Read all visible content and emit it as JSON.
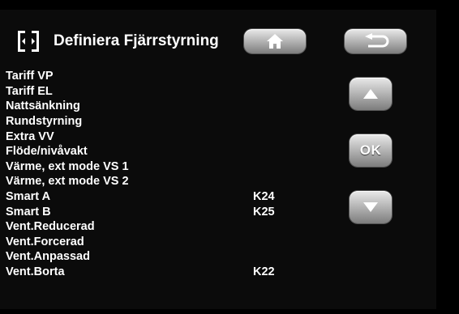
{
  "header": {
    "title": "Definiera Fjärrstyrning",
    "icon": "remote-bracket-icon"
  },
  "buttons": {
    "home": {
      "icon": "home-icon"
    },
    "back": {
      "icon": "back-arrow-icon"
    },
    "up": {
      "icon": "up-arrow-icon"
    },
    "ok": {
      "label": "OK"
    },
    "down": {
      "icon": "down-arrow-icon"
    }
  },
  "rows": [
    {
      "label": "Tariff VP",
      "value": ""
    },
    {
      "label": "Tariff EL",
      "value": ""
    },
    {
      "label": "Nattsänkning",
      "value": ""
    },
    {
      "label": "Rundstyrning",
      "value": ""
    },
    {
      "label": "Extra VV",
      "value": ""
    },
    {
      "label": "Flöde/nivåvakt",
      "value": ""
    },
    {
      "label": "Värme, ext mode VS 1",
      "value": ""
    },
    {
      "label": "Värme, ext mode VS 2",
      "value": ""
    },
    {
      "label": "Smart A",
      "value": "K24"
    },
    {
      "label": "Smart B",
      "value": "K25"
    },
    {
      "label": "Vent.Reducerad",
      "value": ""
    },
    {
      "label": "Vent.Forcerad",
      "value": ""
    },
    {
      "label": "Vent.Anpassad",
      "value": ""
    },
    {
      "label": "Vent.Borta",
      "value": "K22"
    }
  ],
  "colors": {
    "background": "#0b0b0b",
    "text": "#ffffff",
    "button": "#b8b8b8"
  }
}
